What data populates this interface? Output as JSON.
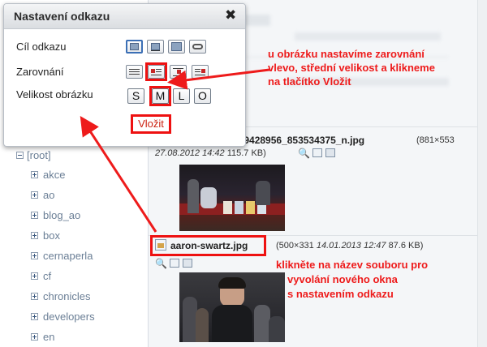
{
  "dialog": {
    "title": "Nastavení odkazu",
    "close_glyph": "✖",
    "link_target_label": "Cíl odkazu",
    "align_label": "Zarovnání",
    "size_label": "Velikost obrázku",
    "sizes": [
      "S",
      "M",
      "L",
      "O"
    ],
    "insert_label": "Vložit"
  },
  "tree": {
    "root_label": "[root]",
    "items": [
      "akce",
      "ao",
      "blog_ao",
      "box",
      "cernaperla",
      "cf",
      "chronicles",
      "developers",
      "en"
    ]
  },
  "files": [
    {
      "name": "859428956_853534375_n.jpg",
      "dims": "(881×553",
      "date": "27.08.2012 14:42",
      "size": "115.7 KB)"
    },
    {
      "name": "aaron-swartz.jpg",
      "dims": "(500×331",
      "date": "14.01.2013 12:47",
      "size": "87.6 KB)"
    }
  ],
  "annotations": {
    "align_note": [
      "u obrázku nastavíme zarovnání",
      "vlevo, střední velikost a klikneme",
      "na tlačítko Vložit"
    ],
    "file_note": [
      "klikněte na název souboru pro",
      "vyvolání nového okna",
      "s nastavením odkazu"
    ]
  },
  "colors": {
    "accent_red": "#ee1b1b",
    "tree_text": "#6b7f96"
  }
}
